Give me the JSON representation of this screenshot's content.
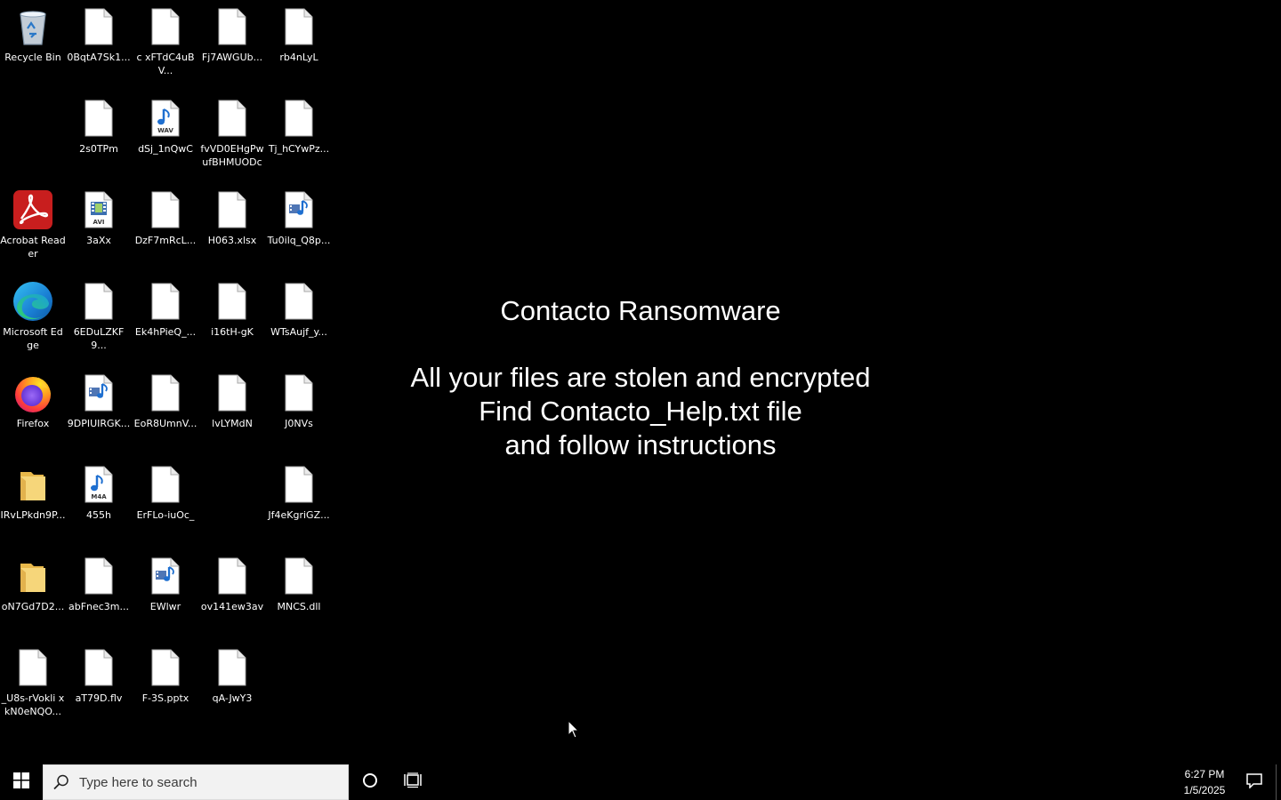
{
  "desktop": {
    "icons": [
      {
        "label": "Recycle Bin",
        "type": "recycle"
      },
      {
        "label": "0BqtA7Sk1...",
        "type": "file"
      },
      {
        "label": "c xFTdC4uBV...",
        "type": "file"
      },
      {
        "label": "Fj7AWGUb...",
        "type": "file"
      },
      {
        "label": "rb4nLyL",
        "type": "file"
      },
      {
        "label": "2s0TPm",
        "type": "file"
      },
      {
        "label": "dSj_1nQwC",
        "type": "wav"
      },
      {
        "label": "fvVD0EHgPw ufBHMUODc",
        "type": "file"
      },
      {
        "label": "Tj_hCYwPz...",
        "type": "file"
      },
      {
        "label": "Acrobat Reader",
        "type": "acrobat"
      },
      {
        "label": "3aXx",
        "type": "avi"
      },
      {
        "label": "DzF7mRcL...",
        "type": "file"
      },
      {
        "label": "H063.xlsx",
        "type": "file"
      },
      {
        "label": "Tu0ilq_Q8p...",
        "type": "media"
      },
      {
        "label": "Microsoft Edge",
        "type": "edge"
      },
      {
        "label": "6EDuLZKF9...",
        "type": "file"
      },
      {
        "label": "Ek4hPieQ_...",
        "type": "file"
      },
      {
        "label": "i16tH-gK",
        "type": "file"
      },
      {
        "label": "WTsAujf_y...",
        "type": "file"
      },
      {
        "label": "Firefox",
        "type": "firefox"
      },
      {
        "label": "9DPIUIRGK...",
        "type": "media"
      },
      {
        "label": "EoR8UmnV...",
        "type": "file"
      },
      {
        "label": "lvLYMdN",
        "type": "file"
      },
      {
        "label": "J0NVs",
        "type": "file"
      },
      {
        "label": "IRvLPkdn9P...",
        "type": "folder"
      },
      {
        "label": "455h",
        "type": "m4a"
      },
      {
        "label": "ErFLo-iuOc_",
        "type": "file"
      },
      {
        "label": "Jf4eKgriGZ...",
        "type": "file"
      },
      {
        "label": "oN7Gd7D2...",
        "type": "folder"
      },
      {
        "label": "abFnec3m...",
        "type": "file"
      },
      {
        "label": "EWlwr",
        "type": "media"
      },
      {
        "label": "ov141ew3av",
        "type": "file"
      },
      {
        "label": "MNCS.dll",
        "type": "file"
      },
      {
        "label": "_U8s-rVokli xkN0eNQO...",
        "type": "file"
      },
      {
        "label": "aT79D.flv",
        "type": "file"
      },
      {
        "label": "F-3S.pptx",
        "type": "file"
      },
      {
        "label": "qA-JwY3",
        "type": "file"
      }
    ]
  },
  "ransom_note": {
    "title": "Contacto Ransomware",
    "line1": "All your files are stolen and encrypted",
    "line2": "Find Contacto_Help.txt file",
    "line3": "and follow instructions"
  },
  "taskbar": {
    "search_placeholder": "Type here to search",
    "time": "6:27 PM",
    "date": "1/5/2025"
  },
  "ext_tags": {
    "wav": "WAV",
    "avi": "AVI",
    "m4a": "M4A"
  }
}
